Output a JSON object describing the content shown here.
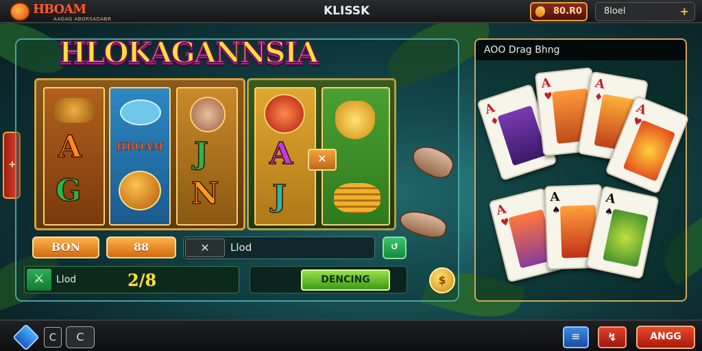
{
  "header": {
    "logo_text": "HBOAM",
    "logo_subtext": "AAGAG ABORSADABR",
    "title": "KLISSK",
    "coins_value": "80.R0",
    "account_label": "8loel",
    "add_symbol": "+"
  },
  "slot": {
    "game_title": "HLOKAGANNSIA",
    "side_tab_symbol": "+",
    "reel_symbols": [
      "A",
      "G",
      "HBOAM",
      "J",
      "N",
      "A",
      "J"
    ],
    "mini_button_symbol": "✕",
    "stake_button": "BON",
    "bet_button": "88",
    "close_symbol": "✕",
    "play_label": "Llod",
    "refresh_symbol": "↺",
    "balance_label": "Llod",
    "balance_value": "2/8",
    "action_button": "DENCING",
    "coin_symbol": "$"
  },
  "cards": {
    "header": "AOO Drag Bhng",
    "items": [
      {
        "rank": "A",
        "suit": "♦",
        "color": "#c0202a"
      },
      {
        "rank": "A",
        "suit": "♥",
        "color": "#c0202a"
      },
      {
        "rank": "A",
        "suit": "♦",
        "color": "#c0202a"
      },
      {
        "rank": "A",
        "suit": "♥",
        "color": "#c0202a"
      },
      {
        "rank": "A",
        "suit": "♥",
        "color": "#c0202a"
      },
      {
        "rank": "A",
        "suit": "♠",
        "color": "#111111"
      },
      {
        "rank": "A",
        "suit": "♠",
        "color": "#111111"
      }
    ]
  },
  "footer": {
    "c_button": "C",
    "c2_button": "C",
    "blue_button": "≡",
    "red_button": "↯",
    "main_button": "ANGG"
  },
  "colors": {
    "accent_gold": "#ffd070",
    "brand_orange": "#ff5a2a",
    "title_yellow": "#ffde3c"
  }
}
